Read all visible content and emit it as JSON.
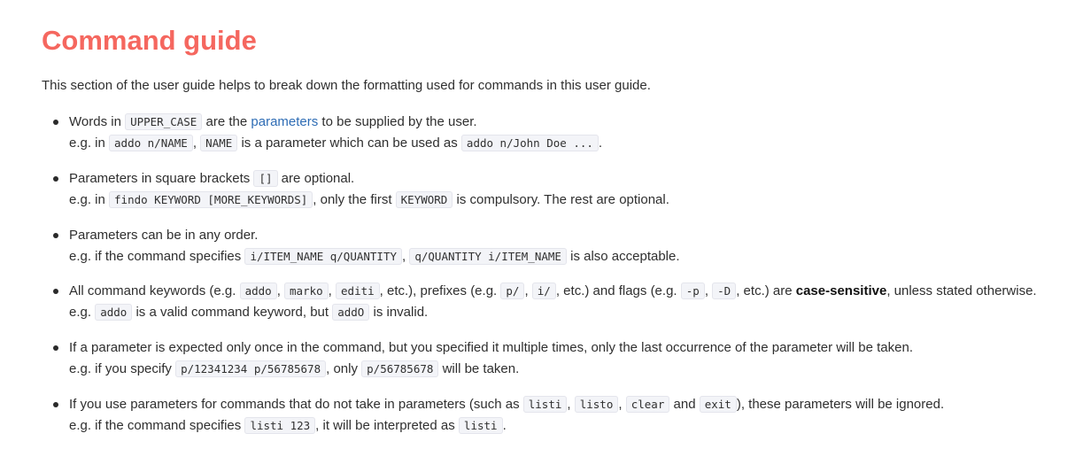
{
  "title": "Command guide",
  "intro": "This section of the user guide helps to break down the formatting used for commands in this user guide.",
  "items": [
    {
      "l1": [
        "Words in ",
        {
          "code": "UPPER_CASE"
        },
        " are the ",
        {
          "link": "parameters"
        },
        " to be supplied by the user."
      ],
      "l2": [
        "e.g. in ",
        {
          "code": "addo n/NAME"
        },
        ", ",
        {
          "code": "NAME"
        },
        " is a parameter which can be used as ",
        {
          "code": "addo n/John Doe ..."
        },
        "."
      ]
    },
    {
      "l1": [
        "Parameters in square brackets ",
        {
          "code": "[]"
        },
        " are optional."
      ],
      "l2": [
        "e.g. in ",
        {
          "code": "findo KEYWORD [MORE_KEYWORDS]"
        },
        ", only the first ",
        {
          "code": "KEYWORD"
        },
        " is compulsory. The rest are optional."
      ]
    },
    {
      "l1": [
        "Parameters can be in any order."
      ],
      "l2": [
        "e.g. if the command specifies ",
        {
          "code": "i/ITEM_NAME q/QUANTITY"
        },
        ", ",
        {
          "code": "q/QUANTITY i/ITEM_NAME"
        },
        " is also acceptable."
      ]
    },
    {
      "l1": [
        "All command keywords (e.g. ",
        {
          "code": "addo"
        },
        ", ",
        {
          "code": "marko"
        },
        ", ",
        {
          "code": "editi"
        },
        ", etc.), prefixes (e.g. ",
        {
          "code": "p/"
        },
        ", ",
        {
          "code": "i/"
        },
        ", etc.) and flags (e.g. ",
        {
          "code": "-p"
        },
        ", ",
        {
          "code": "-D"
        },
        ", etc.) are ",
        {
          "bold": "case-sensitive"
        },
        ", unless stated otherwise."
      ],
      "l2": [
        "e.g. ",
        {
          "code": "addo"
        },
        " is a valid command keyword, but ",
        {
          "code": "addO"
        },
        " is invalid."
      ]
    },
    {
      "l1": [
        "If a parameter is expected only once in the command, but you specified it multiple times, only the last occurrence of the parameter will be taken."
      ],
      "l2": [
        "e.g. if you specify ",
        {
          "code": "p/12341234 p/56785678"
        },
        ", only ",
        {
          "code": "p/56785678"
        },
        " will be taken."
      ]
    },
    {
      "l1": [
        "If you use parameters for commands that do not take in parameters (such as ",
        {
          "code": "listi"
        },
        ", ",
        {
          "code": "listo"
        },
        ", ",
        {
          "code": "clear"
        },
        " and ",
        {
          "code": "exit"
        },
        "), these parameters will be ignored."
      ],
      "l2": [
        "e.g. if the command specifies ",
        {
          "code": "listi 123"
        },
        ", it will be interpreted as ",
        {
          "code": "listi"
        },
        "."
      ]
    }
  ]
}
